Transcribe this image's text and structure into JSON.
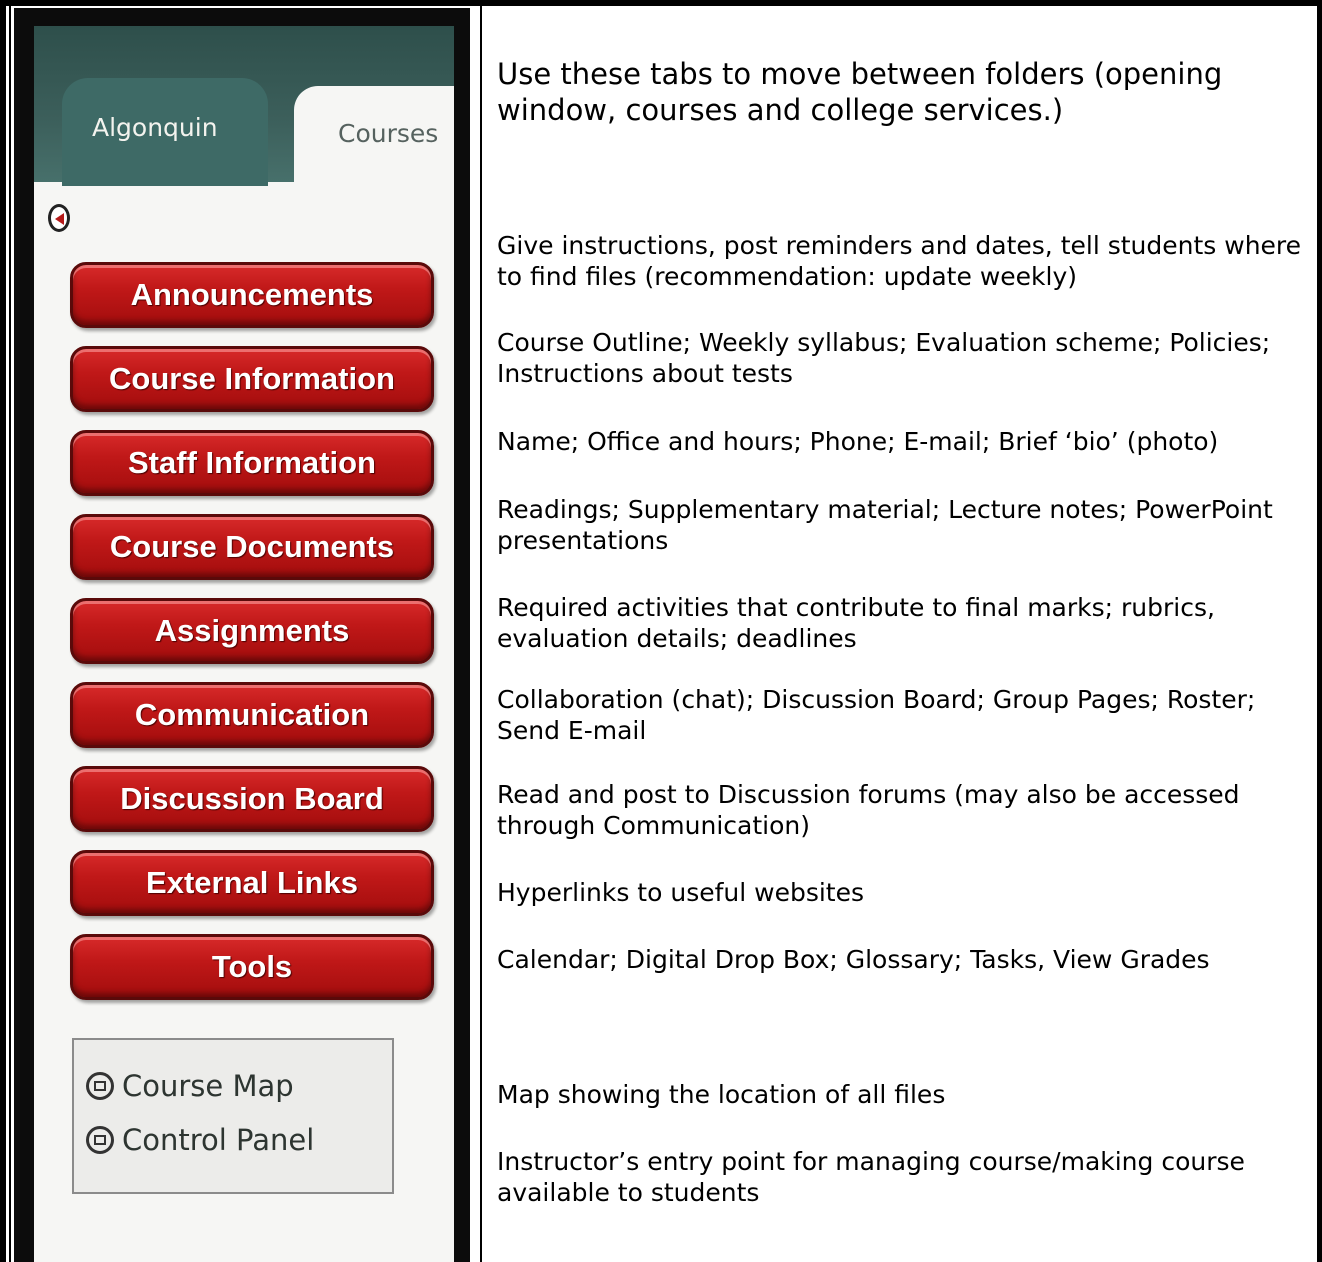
{
  "tabs": {
    "algonquin": "Algonquin",
    "courses": "Courses"
  },
  "menu": [
    {
      "label": "Announcements"
    },
    {
      "label": "Course Information"
    },
    {
      "label": "Staff Information"
    },
    {
      "label": "Course Documents"
    },
    {
      "label": "Assignments"
    },
    {
      "label": "Communication"
    },
    {
      "label": "Discussion Board"
    },
    {
      "label": "External Links"
    },
    {
      "label": "Tools"
    }
  ],
  "bottom_links": {
    "course_map": "Course Map",
    "control_panel": "Control Panel"
  },
  "descriptions": {
    "tabs": "Use these tabs to move between folders (opening window, courses and college services.)",
    "announcements": "Give instructions, post reminders and dates, tell students where to find files (recommendation: update weekly)",
    "course_information": "Course Outline; Weekly syllabus; Evaluation scheme; Policies; Instructions about tests",
    "staff_information": "Name; Office and hours; Phone; E-mail; Brief ‘bio’ (photo)",
    "course_documents": "Readings; Supplementary material; Lecture notes; PowerPoint presentations",
    "assignments": "Required activities that contribute to final marks; rubrics, evaluation details; deadlines",
    "communication": "Collaboration (chat); Discussion Board; Group Pages; Roster; Send E-mail",
    "discussion_board": "Read and post to Discussion forums  (may also be accessed through Communication)",
    "external_links": "Hyperlinks to useful websites",
    "tools": "Calendar; Digital Drop Box; Glossary; Tasks, View Grades",
    "course_map": "Map showing the location of all files",
    "control_panel": "Instructor’s entry point for managing course/making course available to students"
  }
}
